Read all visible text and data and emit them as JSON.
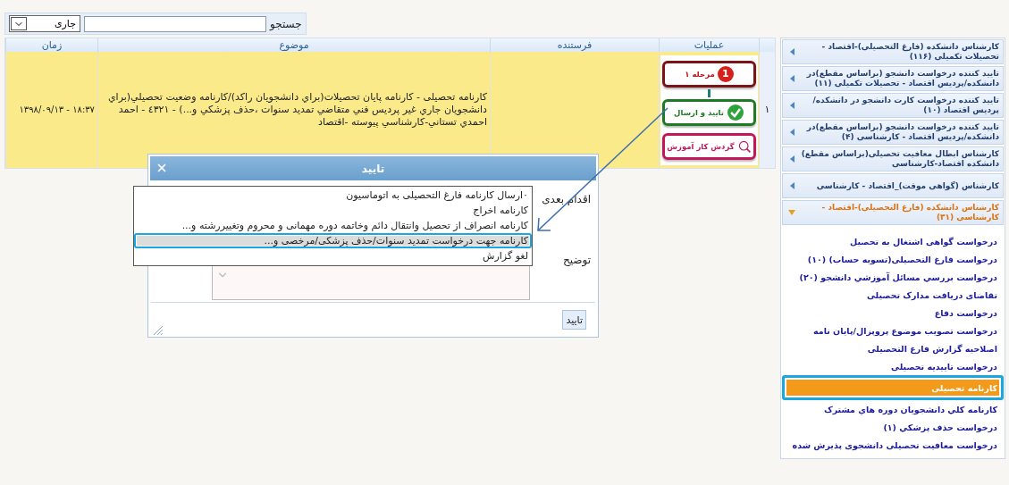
{
  "search": {
    "label": "جستجو",
    "filter": {
      "value": "جاری"
    }
  },
  "table": {
    "columns": [
      {
        "label": "عملیات"
      },
      {
        "label": "فرستنده"
      },
      {
        "label": "موضوع"
      },
      {
        "label": "زمان"
      }
    ],
    "rows": [
      {
        "number": "۱",
        "selected": true,
        "actions": [
          {
            "kind": "stage",
            "label": "مرحله ۱",
            "badge": "1"
          },
          {
            "kind": "approve",
            "label": "تایید و ارسال"
          },
          {
            "kind": "workflow",
            "label": "گردش کار آموزش"
          }
        ],
        "subject": "کارنامه تحصیلی - کارنامه پایان تحصیلات(براي دانشجويان راکد)/کارنامه وضعيت تحصيلي(براي دانشجويان جاري غير پرديس فني متقاضي تمديد سنوات ،حذف پزشکي و...) - ٤٣٢١ - احمد احمدي تستاني-کارشناسي پيوسته -اقتصاد",
        "time": "۱۸:۳۷ - ۱۳۹۸/۰۹/۱۳"
      }
    ]
  },
  "dialog": {
    "title": "تایید",
    "next_step": {
      "label": "اقدام بعدی",
      "options": [
        {
          "label": "۰ارسال کارنامه فارغ التحصیلی به اتوماسیون",
          "selected": false,
          "highlighted": false
        },
        {
          "label": "کارنامه اخراج",
          "selected": false,
          "highlighted": false
        },
        {
          "label": "کارنامه انصراف از تحصیل وانتقال دائم وخاتمه دوره مهمانی و محروم وتغییررشته و...",
          "selected": false,
          "highlighted": false
        },
        {
          "label": "کارنامه جهت درخواست تمدید سنوات/حذف پزشکی/مرخصی و...",
          "selected": true,
          "highlighted": true
        },
        {
          "label": "لغو گزارش",
          "selected": false,
          "highlighted": false
        }
      ]
    },
    "description": {
      "label": "توضیح"
    },
    "button": "تایید"
  },
  "sidebar": {
    "groups": [
      {
        "title": "کارشناس دانشکده (فارغ التحصیلی)-اقتصاد - تحصیلات تکمیلی (۱۱۶)",
        "expanded": false
      },
      {
        "title": "تایید کننده درخواست دانشجو (براساس مقطع)در دانشکده/پردیس اقتصاد - تحصیلات تکمیلی (۱۱)",
        "expanded": false
      },
      {
        "title": "تایید کننده درخواست کارت دانشجو در دانشکده/پردیس اقتصاد (۱۰)",
        "expanded": false
      },
      {
        "title": "تایید کننده درخواست دانشجو (براساس مقطع)در دانشکده/پردیس اقتصاد - کارشناسی (۴)",
        "expanded": false
      },
      {
        "title": "کارشناس ابطال معافیت تحصیلی(براساس مقطع) دانشکده اقتصاد-کارشناسی",
        "expanded": false
      },
      {
        "title": "کارشناس (گواهی موقت)_اقتصاد - کارشناسی",
        "expanded": false
      },
      {
        "title": "کارشناس دانشکده (فارغ التحصیلی)-اقتصاد - کارشناسی (۳۱)",
        "expanded": true,
        "items": [
          {
            "label": "درخواست گواهی اشتغال به تحصیل",
            "selected": false,
            "highlighted": false
          },
          {
            "label": "درخواست فارغ التحصیلی(تسویه حساب) (۱۰)",
            "selected": false,
            "highlighted": false
          },
          {
            "label": "درخواست بررسي مسائل آموزشي دانشجو (۲۰)",
            "selected": false,
            "highlighted": false
          },
          {
            "label": "تقاضای دریافت مدارک تحصیلی",
            "selected": false,
            "highlighted": false
          },
          {
            "label": "درخواست دفاع",
            "selected": false,
            "highlighted": false
          },
          {
            "label": "درخواست تصویب موضوع پروپزال/پایان نامه",
            "selected": false,
            "highlighted": false
          },
          {
            "label": "اصلاحیه گزارش فارغ التحصیلی",
            "selected": false,
            "highlighted": false
          },
          {
            "label": "درخواست تاییدیه تحصیلی",
            "selected": false,
            "highlighted": false
          },
          {
            "label": "کارنامه تحصیلی",
            "selected": true,
            "highlighted": true
          },
          {
            "label": "کارنامه کلي دانشجويان دوره هاي مشترک",
            "selected": false,
            "highlighted": false
          },
          {
            "label": "درخواست حذف پزشکي (۱)",
            "selected": false,
            "highlighted": false
          },
          {
            "label": "درخواست معافیت تحصیلی دانشجوی پذیرش شده",
            "selected": false,
            "highlighted": false
          }
        ]
      }
    ]
  }
}
